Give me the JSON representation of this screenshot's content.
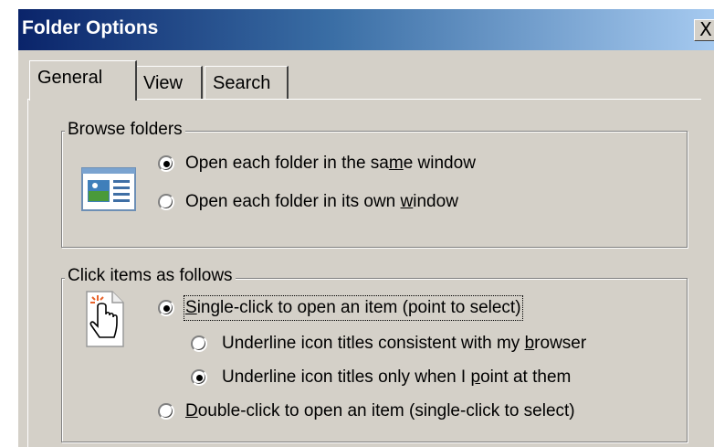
{
  "window": {
    "title": "Folder Options",
    "close_label": "X"
  },
  "tabs": [
    {
      "label": "General",
      "active": true
    },
    {
      "label": "View",
      "active": false
    },
    {
      "label": "Search",
      "active": false
    }
  ],
  "browse_group": {
    "legend": "Browse folders",
    "options": [
      {
        "pre": "Open each folder in the sa",
        "ul": "m",
        "post": "e window",
        "selected": true
      },
      {
        "pre": "Open each folder in its own ",
        "ul": "w",
        "post": "indow",
        "selected": false
      }
    ]
  },
  "click_group": {
    "legend": "Click items as follows",
    "single_click": {
      "pre": "",
      "ul": "S",
      "post": "ingle-click to open an item (point to select)",
      "selected": true
    },
    "underline_browser": {
      "pre": "Underline icon titles consistent with my ",
      "ul": "b",
      "post": "rowser",
      "selected": false
    },
    "underline_point": {
      "pre": "Underline icon titles only when I ",
      "ul": "p",
      "post": "oint at them",
      "selected": true
    },
    "double_click": {
      "pre": "",
      "ul": "D",
      "post": "ouble-click to open an item (single-click to select)",
      "selected": false
    }
  },
  "icons": {
    "browse": "folder-window-icon",
    "click": "hand-pointer-icon"
  }
}
